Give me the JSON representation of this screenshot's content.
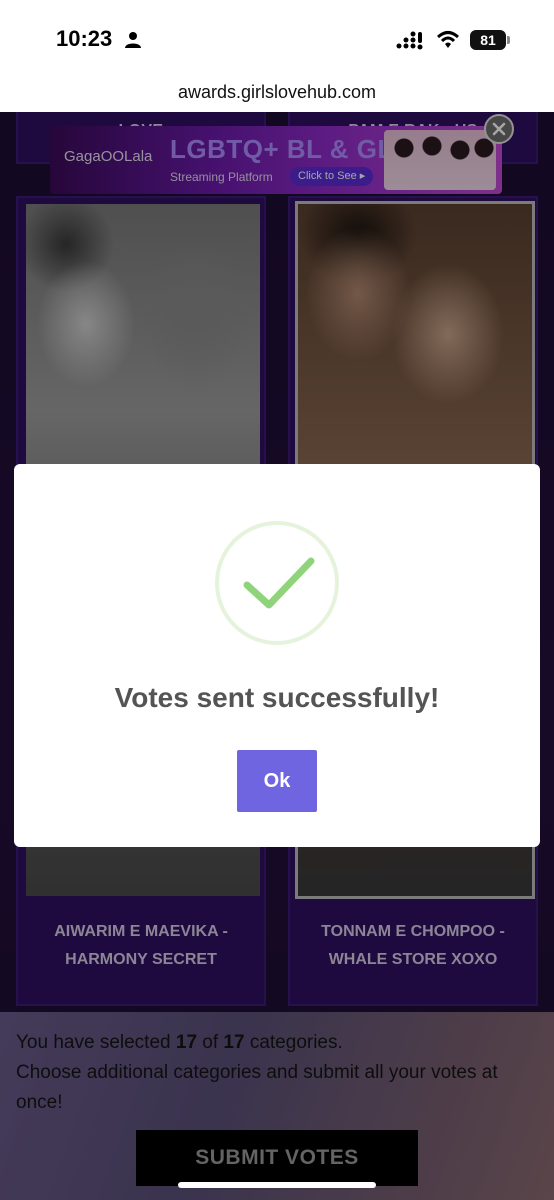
{
  "status_bar": {
    "time": "10:23",
    "battery": "81",
    "icons": [
      "person-icon",
      "signal-icon",
      "wifi-icon",
      "battery-icon"
    ]
  },
  "browser": {
    "url": "awards.girlslovehub.com"
  },
  "cards": {
    "top_left_label": "LOVE",
    "top_right_label": "PAM E RAK - US",
    "left": {
      "caption_line1": "AIWARIM E MAEVIKA -",
      "caption_line2": "HARMONY SECRET"
    },
    "right": {
      "caption_line1": "TONNAM E CHOMPOO -",
      "caption_line2": "WHALE STORE XOXO"
    }
  },
  "ad": {
    "brand": "GagaOOLala",
    "title": "LGBTQ+ BL & GL",
    "subtitle": "Streaming Platform",
    "cta": "Click to See ▸"
  },
  "modal": {
    "title": "Votes sent successfully!",
    "ok_label": "Ok",
    "check_color": "#8fd47a"
  },
  "bottom": {
    "text_prefix": "You have selected ",
    "selected": "17",
    "text_of": " of ",
    "total": "17",
    "text_suffix": " categories.",
    "line2": "Choose additional categories and submit all your votes at once!",
    "submit_label": "SUBMIT VOTES"
  }
}
